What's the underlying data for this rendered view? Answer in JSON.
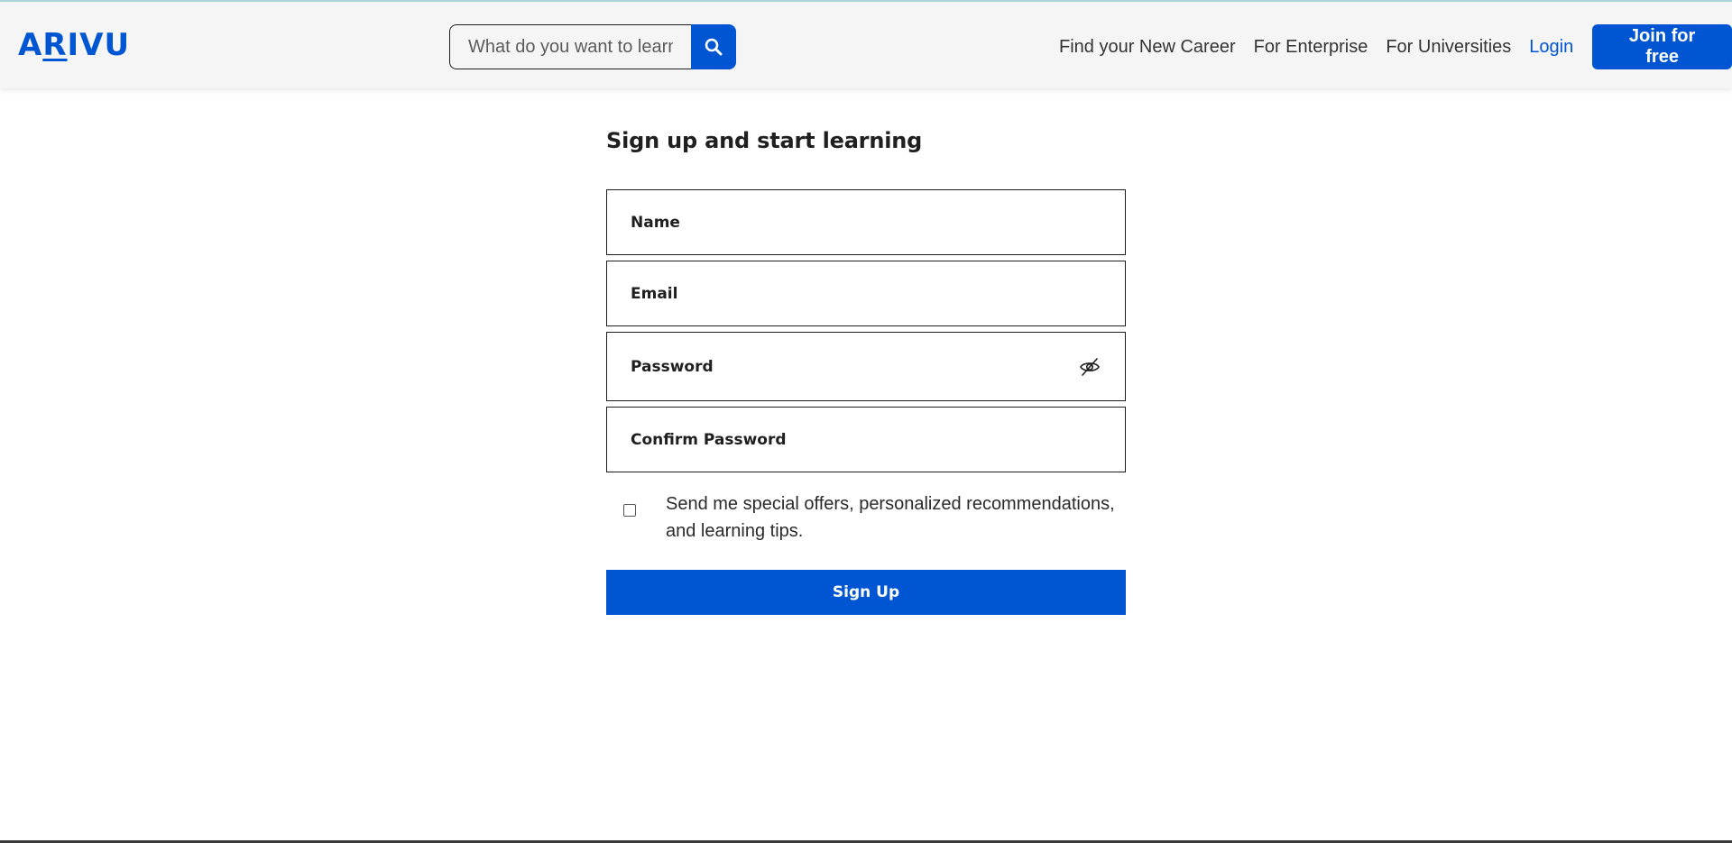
{
  "header": {
    "logo_prefix": "A",
    "logo_underlined": "R",
    "logo_suffix": "IVU",
    "search": {
      "placeholder": "What do you want to learn?",
      "icon": "search-icon"
    },
    "nav_links": [
      "Find your New Career",
      "For Enterprise",
      "For Universities"
    ],
    "login_label": "Login",
    "join_label": "Join for free"
  },
  "form": {
    "title": "Sign up and start learning",
    "fields": {
      "name": "Name",
      "email": "Email",
      "password": "Password",
      "confirm_password": "Confirm Password"
    },
    "password_toggle_icon": "eye-slash-icon",
    "consent_text": "Send me special offers, personalized recommendations, and learning tips.",
    "consent_checked": false,
    "submit_label": "Sign Up"
  },
  "colors": {
    "brand": "#0056d2",
    "navbar_bg": "#f5f5f6",
    "text": "#1f1f1f"
  }
}
